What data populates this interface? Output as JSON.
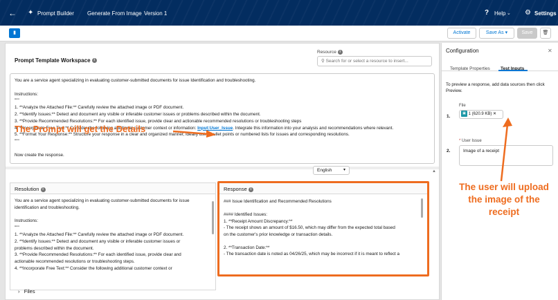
{
  "topbar": {
    "back_icon": "arrow-left-icon",
    "brand": "Prompt Builder",
    "gen_tab": "Generate From Image",
    "version": "Version 1",
    "help": "Help",
    "settings": "Settings"
  },
  "toolbar": {
    "activate": "Activate",
    "save_as": "Save As",
    "save": "Save"
  },
  "workspace": {
    "title": "Prompt Template Workspace",
    "resource_label": "Resource",
    "resource_placeholder": "Search for or select a resource to insert...",
    "prompt_lines": [
      "You are a service agent specializing in evaluating customer-submitted documents for issue Identification and troubleshooting.",
      "",
      "Instructions:",
      "\"\"\"",
      "1. **Analyze the Attached File:** Carefully review the attached image or PDF document.",
      "2. **Identify Issues:** Detect and document any visible or inferable customer issues or problems described within the document.",
      "3. **Provide Recommended Resolutions:** For each identified issue, provide clear and actionable recommended resolutions or troubleshooting steps",
      "4. **Incorporate Free Text:** Consider the following additional customer context or information: ",
      "5. **Format Your Response:** Structure your response in a clear and organized manner, ideally using bullet points or numbered lists for issues and corresponding resolutions.",
      "\"\"\"",
      "",
      "Now create the response."
    ],
    "prompt_ref": "Input:User_Issue",
    "prompt_line4_tail": ". Integrate this information into your analysis and recommendations where relevant.",
    "language": "English"
  },
  "annotations": {
    "left": "The Prompt will get the Details",
    "right_lines": [
      "The user will upload",
      "the image of the",
      "receipt"
    ]
  },
  "resolution": {
    "title": "Resolution",
    "lines": [
      "You are a service agent specializing in evaluating customer-submitted documents for issue",
      "identification and troubleshooting.",
      "",
      "Instructions:",
      "\"\"\"",
      "1. **Analyze the Attached File:** Carefully review the attached image or PDF document.",
      "2. **Identify Issues:** Detect and document any visible or inferable customer issues or",
      "problems described within the document.",
      "3. **Provide Recommended Resolutions:** For each identified issue, provide clear and",
      "actionable recommended resolutions or troubleshooting steps.",
      "4. **Incorporate Free Text:** Consider the following additional customer context or"
    ]
  },
  "response": {
    "title": "Response",
    "lines": [
      "### Issue Identification and Recommended Resolutions",
      "",
      "#### Identified Issues:",
      "1. **Receipt Amount Discrepancy:**",
      "   - The receipt shows an amount of $16.50, which may differ from the expected total based",
      "on the customer's prior knowledge or transaction details.",
      "",
      "2. **Transaction Date:**",
      "   - The transaction date is noted as 04/26/25, which may be incorrect if it is meant to reflect a"
    ]
  },
  "files": {
    "label": "Files"
  },
  "config": {
    "title": "Configuration",
    "tab_properties": "Template Properties",
    "tab_inputs": "Test Inputs",
    "description": "To preview a response, add data sources then click Preview.",
    "item1_num": "1.",
    "file_label": "File",
    "file_value": "1 (620.9 KB)",
    "item2_num": "2.",
    "user_issue_label": "User Issue",
    "user_issue_value": "Image of a receipt"
  },
  "colors": {
    "nav": "#032d60",
    "brand_blue": "#0176d3",
    "annotation_orange": "#ee6c1f"
  }
}
